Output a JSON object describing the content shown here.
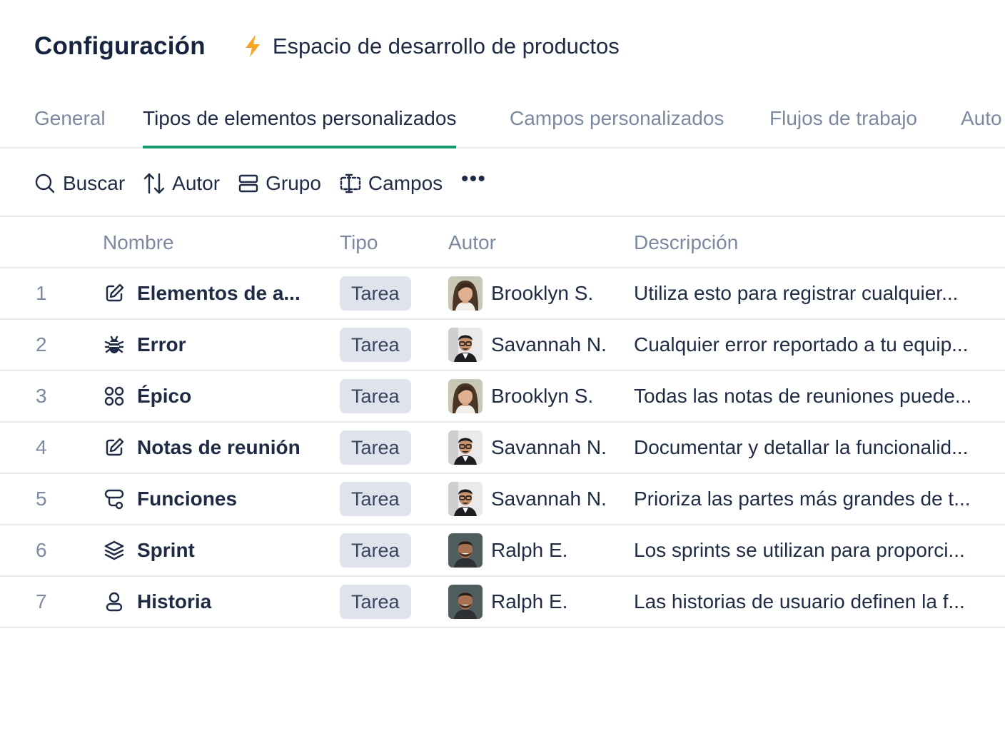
{
  "header": {
    "title": "Configuración",
    "space_icon": "lightning-bolt-icon",
    "space_icon_color": "#f5a623",
    "space_name": "Espacio de desarrollo de productos"
  },
  "tabs": [
    {
      "label": "General",
      "active": false
    },
    {
      "label": "Tipos de elementos personalizados",
      "active": true
    },
    {
      "label": "Campos personalizados",
      "active": false
    },
    {
      "label": "Flujos de trabajo",
      "active": false
    },
    {
      "label": "Auto",
      "active": false
    }
  ],
  "accent_color": "#149a6e",
  "toolbar": {
    "search_label": "Buscar",
    "sort_label": "Autor",
    "group_label": "Grupo",
    "fields_label": "Campos",
    "more_label": "•••"
  },
  "table": {
    "columns": [
      "Nombre",
      "Tipo",
      "Autor",
      "Descripción"
    ],
    "rows": [
      {
        "num": "1",
        "icon": "edit-square-icon",
        "name": "Elementos de a...",
        "type": "Tarea",
        "author": "Brooklyn S.",
        "avatar": "avatar-brooklyn",
        "description": "Utiliza esto para registrar cualquier..."
      },
      {
        "num": "2",
        "icon": "bug-icon",
        "name": "Error",
        "type": "Tarea",
        "author": "Savannah N.",
        "avatar": "avatar-savannah",
        "description": "Cualquier error reportado a tu equip..."
      },
      {
        "num": "3",
        "icon": "grid-circles-icon",
        "name": "Épico",
        "type": "Tarea",
        "author": "Brooklyn S.",
        "avatar": "avatar-brooklyn",
        "description": "Todas las notas de reuniones puede..."
      },
      {
        "num": "4",
        "icon": "edit-square-icon",
        "name": "Notas de reunión",
        "type": "Tarea",
        "author": "Savannah N.",
        "avatar": "avatar-savannah",
        "description": "Documentar y detallar la funcionalid..."
      },
      {
        "num": "5",
        "icon": "route-icon",
        "name": "Funciones",
        "type": "Tarea",
        "author": "Savannah N.",
        "avatar": "avatar-savannah",
        "description": "Prioriza las partes más grandes de t..."
      },
      {
        "num": "6",
        "icon": "layers-icon",
        "name": "Sprint",
        "type": "Tarea",
        "author": "Ralph E.",
        "avatar": "avatar-ralph",
        "description": "Los sprints se utilizan para proporci..."
      },
      {
        "num": "7",
        "icon": "user-icon",
        "name": "Historia",
        "type": "Tarea",
        "author": "Ralph E.",
        "avatar": "avatar-ralph",
        "description": "Las historias de usuario definen la f..."
      }
    ]
  }
}
